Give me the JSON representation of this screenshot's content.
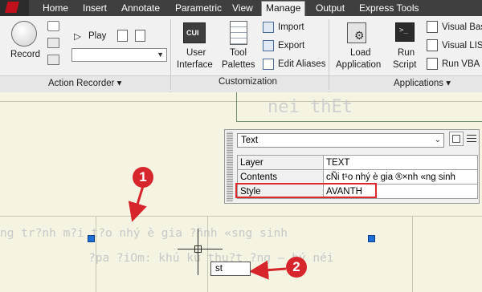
{
  "ribbon": {
    "tabs": [
      "Home",
      "Insert",
      "Annotate",
      "Parametric",
      "View",
      "Manage",
      "Output",
      "Express Tools"
    ],
    "active_tab": "Manage",
    "panels": {
      "action_recorder": {
        "title": "Action Recorder ▾",
        "record_label": "Record",
        "play_label": "Play"
      },
      "customization": {
        "title": "Customization",
        "user_interface_line1": "User",
        "user_interface_line2": "Interface",
        "cui_badge": "CUI",
        "tool_palettes_line1": "Tool",
        "tool_palettes_line2": "Palettes",
        "import_label": "Import",
        "export_label": "Export",
        "edit_aliases_label": "Edit Aliases"
      },
      "applications": {
        "title": "Applications ▾",
        "load_application_line1": "Load",
        "load_application_line2": "Application",
        "run_script_line1": "Run",
        "run_script_line2": "Script",
        "visual_basic_label": "Visual Bas",
        "visual_lisp_label": "Visual LIS",
        "run_vba_label": "Run VBA"
      }
    }
  },
  "drawing": {
    "mtext_top": "nei thEt",
    "text_line1": "ng tr?nh m?i t?o nhý è gia ?ñnh «sng sinh",
    "text_line2": "?pa ?iOm: khú kù thu?t ?ng – hý néi"
  },
  "quick_properties": {
    "object_type": "Text",
    "rows": [
      {
        "label": "Layer",
        "value": "TEXT"
      },
      {
        "label": "Contents",
        "value": "cÑi t¹o nhý è gia ®×nh «ng sinh"
      },
      {
        "label": "Style",
        "value": "AVANTH"
      }
    ]
  },
  "command_input": "st",
  "annotations": {
    "marker1": "1",
    "marker2": "2"
  },
  "colors": {
    "tab_bar": "#3f3f3f",
    "ribbon_bg": "#f1f1f1",
    "drawing_bg": "#f5f4e3",
    "grip_blue": "#1d6fd6",
    "highlight_red": "#e0282c"
  }
}
